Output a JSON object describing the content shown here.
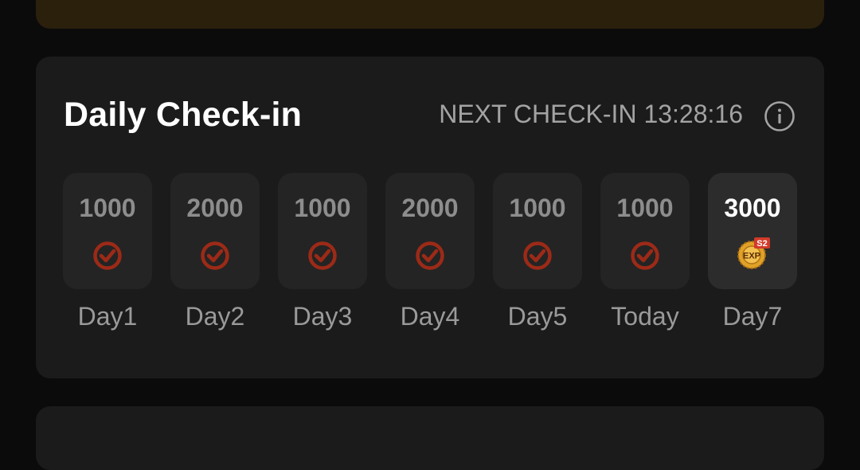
{
  "checkin": {
    "title": "Daily Check-in",
    "next_checkin": "NEXT CHECK-IN 13:28:16",
    "info_icon": "info-icon",
    "days": [
      {
        "amount": "1000",
        "label": "Day1",
        "status": "checked",
        "icon": "check-circle-icon"
      },
      {
        "amount": "2000",
        "label": "Day2",
        "status": "checked",
        "icon": "check-circle-icon"
      },
      {
        "amount": "1000",
        "label": "Day3",
        "status": "checked",
        "icon": "check-circle-icon"
      },
      {
        "amount": "2000",
        "label": "Day4",
        "status": "checked",
        "icon": "check-circle-icon"
      },
      {
        "amount": "1000",
        "label": "Day5",
        "status": "checked",
        "icon": "check-circle-icon"
      },
      {
        "amount": "1000",
        "label": "Today",
        "status": "checked",
        "icon": "check-circle-icon"
      },
      {
        "amount": "3000",
        "label": "Day7",
        "status": "reward",
        "icon": "s2-exp-coin-icon",
        "badge": "S2",
        "coin_text": "EXP"
      }
    ]
  },
  "colors": {
    "background": "#0b0b0b",
    "card": "#1b1b1b",
    "tile": "#242424",
    "check": "#9c2a17",
    "badge": "#d23a2a",
    "coin": "#e0a227"
  }
}
